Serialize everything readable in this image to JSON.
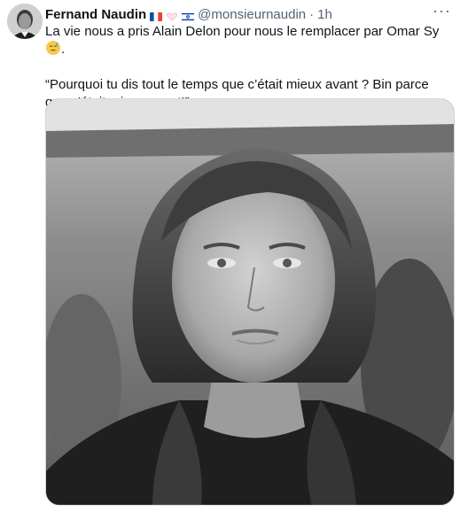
{
  "tweet": {
    "author_name": "Fernand Naudin",
    "handle": "@monsieurnaudin",
    "separator": "·",
    "time": "1h",
    "more_label": "···",
    "line1": "La vie nous a pris Alain Delon pour nous le remplacer par Omar Sy",
    "line1_end": ".",
    "quote": "“Pourquoi tu dis tout le temps que c’était mieux avant ? Bin parce que c’était mieux avant!”",
    "flags": [
      "flag-france-icon",
      "flag-heart-icon",
      "flag-israel-icon"
    ],
    "emoji": "face-emoji-icon"
  },
  "colors": {
    "text": "#0f1419",
    "secondary": "#536471",
    "border": "#cfd9de"
  }
}
